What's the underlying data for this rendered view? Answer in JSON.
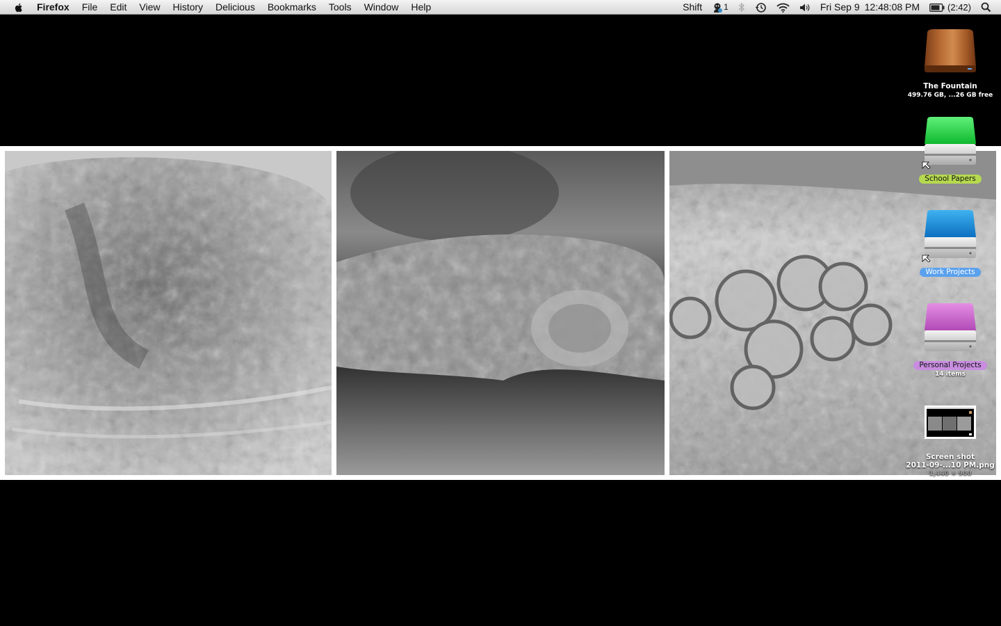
{
  "menubar": {
    "app_name": "Firefox",
    "items": [
      "File",
      "Edit",
      "View",
      "History",
      "Delicious",
      "Bookmarks",
      "Tools",
      "Window",
      "Help"
    ],
    "status": {
      "shift_label": "Shift",
      "notify_count": "1",
      "date": "Fri Sep 9",
      "time": "12:48:08 PM",
      "battery": "(2:42)"
    }
  },
  "desktop": {
    "icons": [
      {
        "label": "The Fountain",
        "sub": "499.76 GB, ...26 GB free",
        "color": "#8a4b22"
      },
      {
        "label": "School Papers",
        "label_color": "#b5d94f",
        "color": "#1ec83c"
      },
      {
        "label": "Work Projects",
        "label_color": "#5aa1ee",
        "color": "#1a8fd6"
      },
      {
        "label": "Personal Projects",
        "sub": "14 items",
        "label_color": "#c88de0",
        "color": "#c860c8"
      },
      {
        "label": "Screen shot",
        "label2": "2011-09-...10 PM.png",
        "sub": "1,440 × 900"
      }
    ]
  },
  "wallpaper": {
    "photos": [
      "oyster-shell-top",
      "oyster-shell-side",
      "oyster-shell-barnacles"
    ]
  }
}
